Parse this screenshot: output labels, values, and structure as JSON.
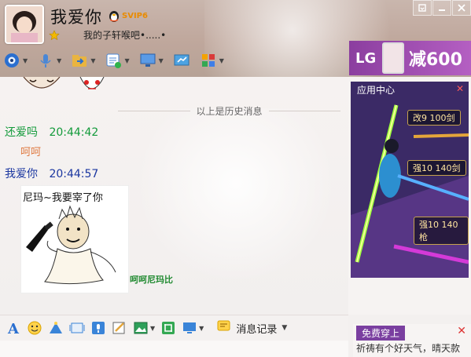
{
  "header": {
    "nickname": "我爱你",
    "vip_badge": "SVIP6",
    "signature": "我的子轩喉吧•.....•"
  },
  "window_controls": [
    "restore-icon",
    "minimize-icon",
    "close-icon"
  ],
  "toolbar_icons": [
    "video-call-icon",
    "voice-call-icon",
    "send-file-icon",
    "sms-icon",
    "remote-desktop-icon",
    "share-screen-icon",
    "apps-icon"
  ],
  "ad_banner": {
    "brand": "LG",
    "promo": "减600",
    "colors": {
      "bg": "#9b4db0"
    }
  },
  "chat": {
    "history_divider": "以上是历史消息",
    "messages": [
      {
        "sender": "还爱吗",
        "time": "20:44:42",
        "text": "呵呵"
      },
      {
        "sender": "我爱你",
        "time": "20:44:57",
        "meme_caption": "尼玛~我要宰了你",
        "meme_tag": "呵呵尼玛比"
      }
    ]
  },
  "app_panel": {
    "title": "应用中心",
    "items": [
      "改9 100剑",
      "强10 140剑",
      "强10 140枪"
    ]
  },
  "input_toolbar": {
    "icons": [
      "font-icon",
      "emoji-icon",
      "magic-icon",
      "window-shake-icon",
      "voice-message-icon",
      "doodle-icon",
      "image-icon",
      "screenshot-icon",
      "screen-share-icon"
    ],
    "history_label": "消息记录"
  },
  "news": {
    "tag": "免费穿上",
    "text": "祈祷有个好天气，晴天款"
  }
}
